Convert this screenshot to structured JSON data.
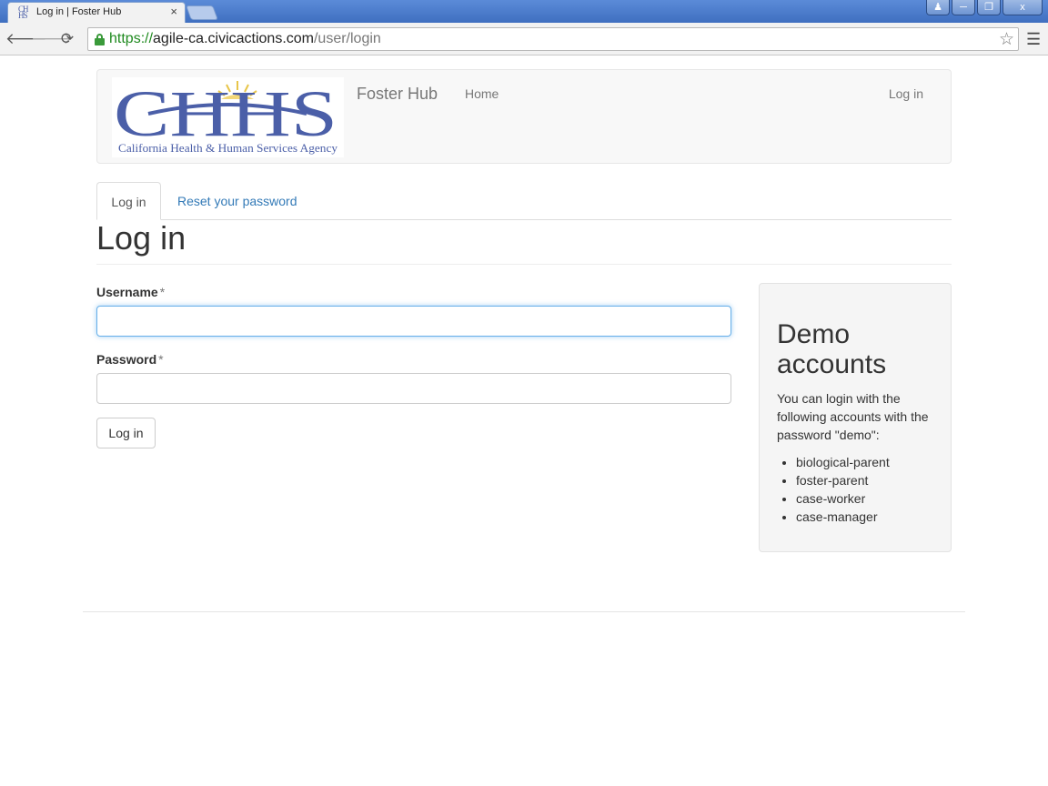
{
  "browser": {
    "tab_title": "Log in | Foster Hub",
    "tab_close": "×",
    "window_controls": [
      "user-icon",
      "minimize-icon",
      "restore-icon",
      "close-icon"
    ],
    "window_close_label": "x",
    "url_scheme": "https://",
    "url_host": "agile-ca.civicactions.com",
    "url_path": "/user/login"
  },
  "header": {
    "logo_text": "CHHS",
    "logo_subtitle": "California Health & Human Services Agency",
    "site_name": "Foster Hub",
    "nav_home": "Home",
    "nav_login": "Log in"
  },
  "tabs": {
    "active": "Log in",
    "reset": "Reset your password"
  },
  "page": {
    "title": "Log in"
  },
  "form": {
    "username_label": "Username",
    "password_label": "Password",
    "required_mark": "*",
    "username_value": "",
    "password_value": "",
    "submit_label": "Log in"
  },
  "demo": {
    "title": "Demo accounts",
    "description": "You can login with the following accounts with the password \"demo\":",
    "accounts": [
      "biological-parent",
      "foster-parent",
      "case-worker",
      "case-manager"
    ]
  },
  "colors": {
    "link": "#337ab7",
    "brand_blue": "#4b5fa8",
    "focus": "#66afe9"
  }
}
